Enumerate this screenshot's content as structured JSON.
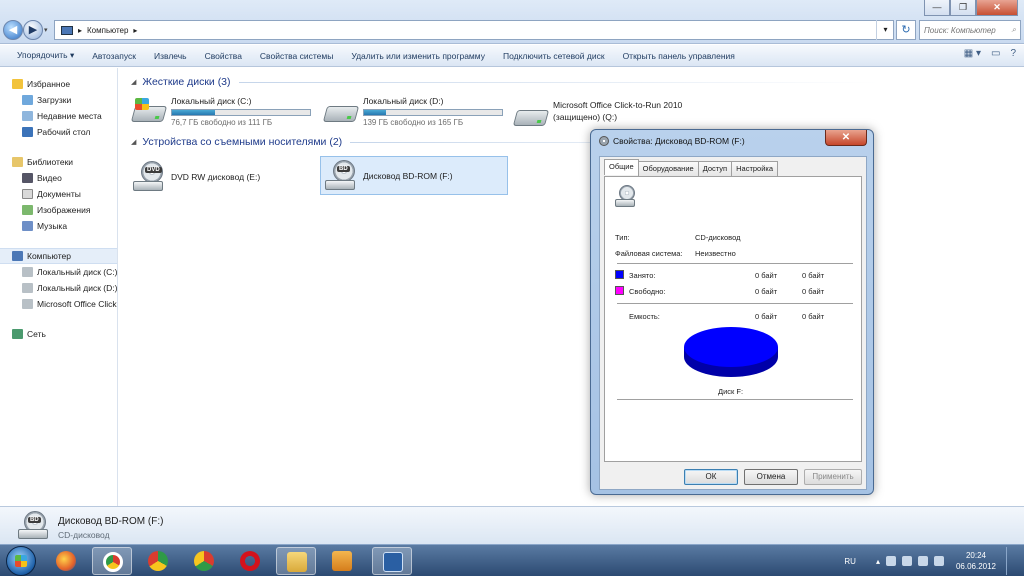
{
  "window": {
    "controls": {
      "minimize": "—",
      "maximize": "❐",
      "close": "✕"
    },
    "address_path": "Компьютер",
    "search_placeholder": "Поиск: Компьютер"
  },
  "toolbar": {
    "items": [
      "Упорядочить ▾",
      "Автозапуск",
      "Извлечь",
      "Свойства",
      "Свойства системы",
      "Удалить или изменить программу",
      "Подключить сетевой диск",
      "Открыть панель управления"
    ]
  },
  "nav": {
    "favorites": "Избранное",
    "downloads": "Загрузки",
    "recent": "Недавние места",
    "desktop": "Рабочий стол",
    "libraries": "Библиотеки",
    "video": "Видео",
    "documents": "Документы",
    "images": "Изображения",
    "music": "Музыка",
    "computer": "Компьютер",
    "local_c": "Локальный диск (C:)",
    "local_d": "Локальный диск (D:)",
    "office": "Microsoft Office Click-to-Run",
    "network": "Сеть"
  },
  "content": {
    "group_hdd": "Жесткие диски (3)",
    "group_removable": "Устройства со съемными носителями (2)",
    "drive_c": {
      "name": "Локальный диск (C:)",
      "free": "76,7 ГБ свободно из 111 ГБ",
      "used_fraction": 0.31
    },
    "drive_d": {
      "name": "Локальный диск (D:)",
      "free": "139 ГБ свободно из 165 ГБ",
      "used_fraction": 0.16
    },
    "drive_q": {
      "name1": "Microsoft Office Click-to-Run 2010",
      "name2": "(защищено) (Q:)"
    },
    "dvd": {
      "name": "DVD RW дисковод (E:)",
      "tag": "DVD"
    },
    "bd": {
      "name": "Дисковод BD-ROM (F:)",
      "tag": "BD"
    }
  },
  "details": {
    "title": "Дисковод BD-ROM (F:)",
    "subtitle": "CD-дисковод"
  },
  "dialog": {
    "title": "Свойства: Дисковод BD-ROM (F:)",
    "tabs": [
      "Общие",
      "Оборудование",
      "Доступ",
      "Настройка"
    ],
    "type_label": "Тип:",
    "type_value": "CD-дисковод",
    "fs_label": "Файловая система:",
    "fs_value": "Неизвестно",
    "used_label": "Занято:",
    "used_bytes": "0 байт",
    "used_size": "0 байт",
    "free_label": "Свободно:",
    "free_bytes": "0 байт",
    "free_size": "0 байт",
    "capacity_label": "Емкость:",
    "capacity_bytes": "0 байт",
    "capacity_size": "0 байт",
    "disk_label": "Диск F:",
    "ok": "ОК",
    "cancel": "Отмена",
    "apply": "Применить",
    "used_color": "#0000ff",
    "free_color": "#ff00ff"
  },
  "taskbar": {
    "lang": "RU",
    "time": "20:24",
    "date": "06.06.2012"
  }
}
